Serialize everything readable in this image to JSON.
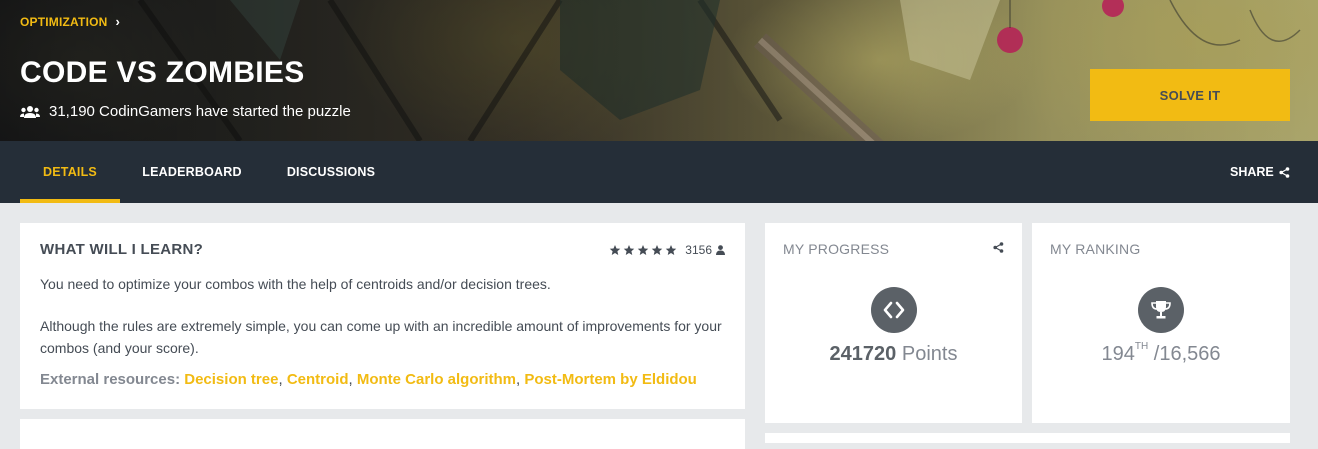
{
  "hero": {
    "breadcrumb": "OPTIMIZATION",
    "title": "CODE VS ZOMBIES",
    "started_text": "31,190 CodinGamers have started the puzzle",
    "solve_label": "SOLVE IT"
  },
  "nav": {
    "tabs": [
      {
        "label": "DETAILS",
        "active": true
      },
      {
        "label": "LEADERBOARD",
        "active": false
      },
      {
        "label": "DISCUSSIONS",
        "active": false
      }
    ],
    "share_label": "SHARE"
  },
  "learn": {
    "heading": "WHAT WILL I LEARN?",
    "rating_count": "3156",
    "stars": 5,
    "paragraph1": "You need to optimize your combos with the help of centroids and/or decision trees.",
    "paragraph2": "Although the rules are extremely simple, you can come up with an incredible amount of improvements for your combos (and your score).",
    "resources_label": "External resources:",
    "resources": [
      "Decision tree",
      "Centroid",
      "Monte Carlo algorithm",
      "Post-Mortem by Eldidou"
    ]
  },
  "progress": {
    "title": "MY PROGRESS",
    "points": "241720",
    "points_label": "Points",
    "icon": "code-icon"
  },
  "ranking": {
    "title": "MY RANKING",
    "rank": "194",
    "rank_suffix": "TH",
    "total": "/16,566",
    "icon": "trophy-icon"
  },
  "colors": {
    "accent": "#f2bb13",
    "nav_bg": "#252e38",
    "text": "#454c55",
    "muted": "#838891"
  }
}
